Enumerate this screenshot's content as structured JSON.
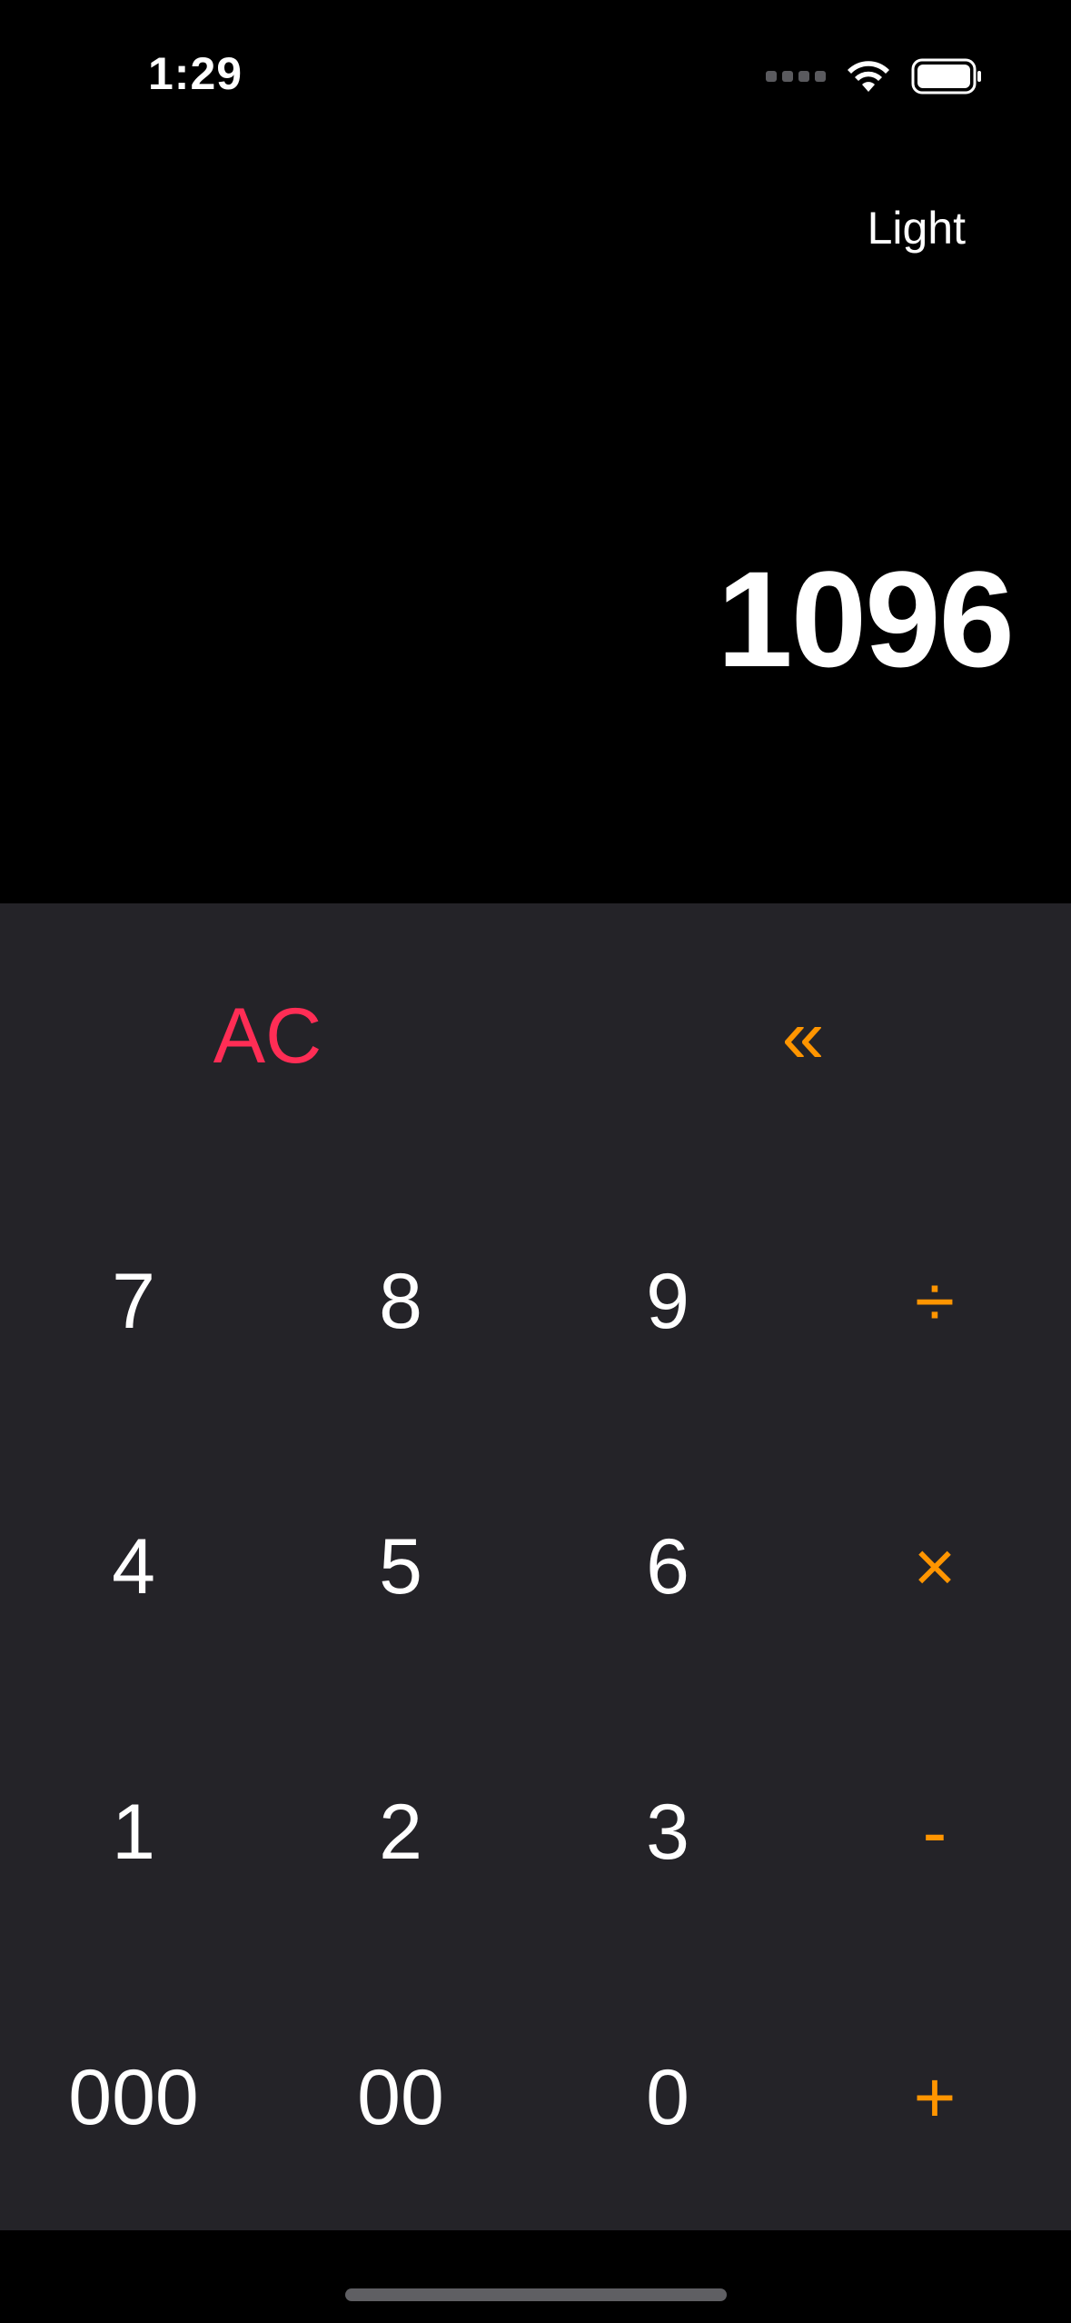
{
  "status_bar": {
    "time": "1:29",
    "icons": [
      "signal-dots-icon",
      "wifi-icon",
      "battery-icon"
    ]
  },
  "header": {
    "theme_label": "Light"
  },
  "display": {
    "value": "1096"
  },
  "keypad": {
    "clear_label": "AC",
    "backspace_label": "«",
    "rows": [
      [
        "7",
        "8",
        "9",
        "÷"
      ],
      [
        "4",
        "5",
        "6",
        "×"
      ],
      [
        "1",
        "2",
        "3",
        "-"
      ],
      [
        "000",
        "00",
        "0",
        "+"
      ]
    ]
  },
  "colors": {
    "background": "#000000",
    "keypad_background": "#242328",
    "operator": "#ff9500",
    "clear": "#ff2d55",
    "text": "#ffffff"
  }
}
